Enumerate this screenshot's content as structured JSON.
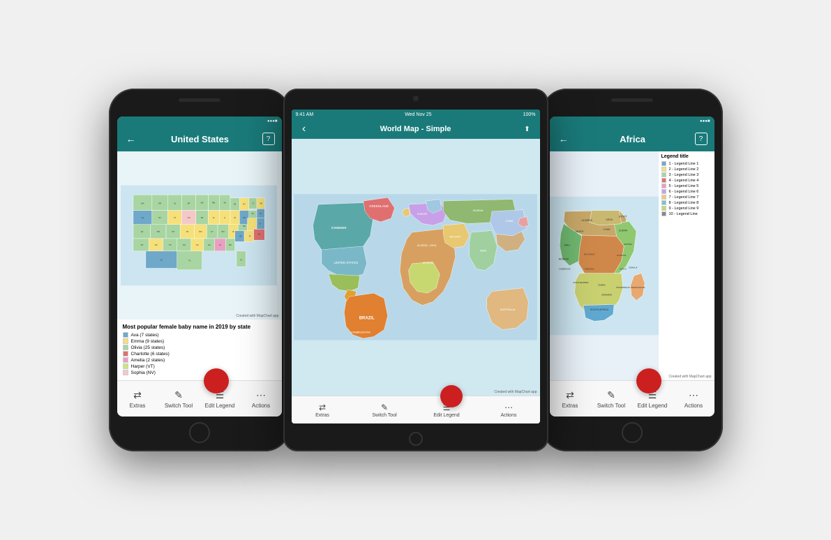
{
  "scene": {
    "background": "#f0f0f0"
  },
  "phone_left": {
    "header": {
      "title": "United States",
      "back_icon": "←",
      "help_icon": "?"
    },
    "status_bar": {
      "signal": "●●●",
      "battery": "█"
    },
    "legend": {
      "title": "Most popular female baby name in 2019 by state",
      "items": [
        {
          "color": "#6fa8c9",
          "label": "Ava (7 states)"
        },
        {
          "color": "#f5e07a",
          "label": "Emma (9 states)"
        },
        {
          "color": "#a8d5a2",
          "label": "Olivia (25 states)"
        },
        {
          "color": "#e07070",
          "label": "Charlotte (6 states)"
        },
        {
          "color": "#e8a0c0",
          "label": "Amelia (2 states)"
        },
        {
          "color": "#c8e87a",
          "label": "Harper (VT)"
        },
        {
          "color": "#f5c8c8",
          "label": "Sophia (NV)"
        }
      ]
    },
    "toolbar": {
      "extras_label": "Extras",
      "switch_label": "Switch Tool",
      "legend_label": "Edit Legend",
      "actions_label": "Actions"
    },
    "map_credit": "Created with MapChart app"
  },
  "tablet_center": {
    "status_bar": {
      "time": "9:41 AM",
      "date": "Wed Nov 25",
      "battery": "100%"
    },
    "header": {
      "title": "World Map - Simple",
      "back_icon": "‹",
      "share_icon": "⬆"
    },
    "toolbar": {
      "extras_label": "Extras",
      "switch_label": "Switch Tool",
      "legend_label": "Edit Legend",
      "actions_label": "Actions"
    },
    "map_credit": "Created with MapChart app"
  },
  "phone_right": {
    "header": {
      "title": "Africa",
      "back_icon": "←",
      "help_icon": "?"
    },
    "legend": {
      "title": "Legend title",
      "items": [
        {
          "color": "#6fa8c9",
          "label": "1 - Legend Line 1"
        },
        {
          "color": "#f5e07a",
          "label": "2 - Legend Line 2"
        },
        {
          "color": "#a8d5a2",
          "label": "3 - Legend Line 3"
        },
        {
          "color": "#e07070",
          "label": "4 - Legend Line 4"
        },
        {
          "color": "#e8a0c0",
          "label": "5 - Legend Line 5"
        },
        {
          "color": "#c8a0e8",
          "label": "6 - Legend Line 6"
        },
        {
          "color": "#f5c870",
          "label": "7 - Legend Line 7"
        },
        {
          "color": "#70c8c8",
          "label": "8 - Legend Line 8"
        },
        {
          "color": "#c8d870",
          "label": "9 - Legend Line 9"
        },
        {
          "color": "#888888",
          "label": "10 - Legend Line"
        }
      ]
    },
    "toolbar": {
      "extras_label": "Extras",
      "switch_label": "Switch Tool",
      "legend_label": "Edit Legend",
      "actions_label": "Actions"
    },
    "map_credit": "Created with MapChart app"
  },
  "icons": {
    "back": "←",
    "help": "?",
    "extras": "⇄",
    "switch": "✎",
    "legend": "☰",
    "actions": "⋯"
  }
}
